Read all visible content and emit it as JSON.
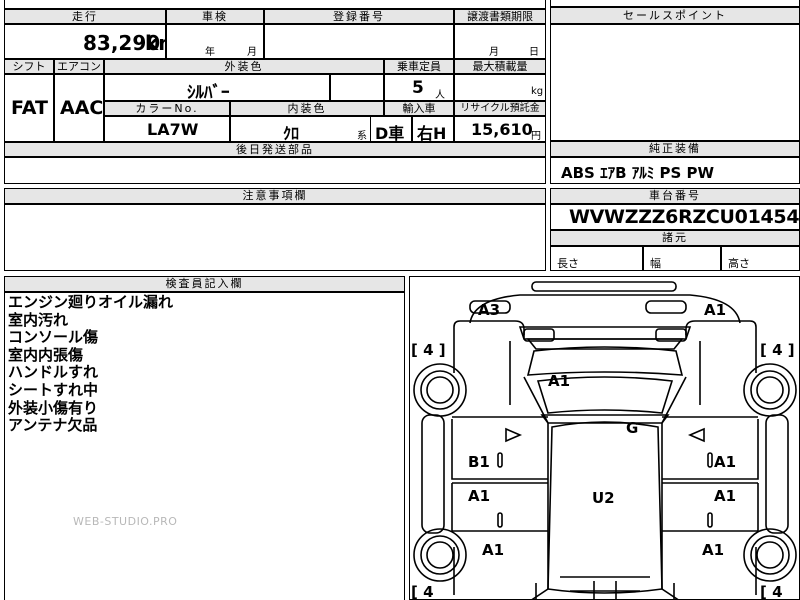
{
  "header": {
    "mileage_label": "走行",
    "inspection_label": "車検",
    "registration_label": "登録番号",
    "transfer_deadline_label": "譲渡書類期限",
    "sales_point_label": "セールスポイント",
    "mileage_value": "83,290",
    "mileage_unit": "km",
    "year_unit": "年",
    "month_unit": "月",
    "deadline_month_unit": "月",
    "deadline_day_unit": "日"
  },
  "spec": {
    "shift_label": "シフト",
    "aircon_label": "エアコン",
    "exterior_color_label": "外装色",
    "capacity_label": "乗車定員",
    "max_load_label": "最大積載量",
    "shift_value": "FAT",
    "aircon_value": "AAC",
    "exterior_color_value": "ｼﾙﾊﾞｰ",
    "capacity_value": "5",
    "capacity_unit": "人",
    "load_unit": "kg",
    "color_no_label": "カラーNo.",
    "interior_color_label": "内装色",
    "import_label": "輸入車",
    "recycle_label": "リサイクル預託金",
    "color_no_value": "LA7W",
    "interior_color_value": "ｸﾛ",
    "interior_suffix": "系",
    "import_value_1": "D車",
    "import_value_2": "右H",
    "recycle_value": "15,610",
    "recycle_unit": "円",
    "later_parts_label": "後日発送部品"
  },
  "equipment": {
    "label": "純正装備",
    "value": "ABS ｴｱB ｱﾙﾐ PS PW"
  },
  "notes_section": {
    "label": "注意事項欄"
  },
  "chassis": {
    "label": "車台番号",
    "value": "WVWZZZ6RZCU014549",
    "dims_label": "諸元",
    "length_label": "長さ",
    "width_label": "幅",
    "height_label": "高さ"
  },
  "inspector": {
    "label": "検査員記入欄",
    "lines": [
      "エンジン廻りオイル漏れ",
      "室内汚れ",
      "コンソール傷",
      "室内内張傷",
      "ハンドルすれ",
      "シートすれ中",
      "外装小傷有り",
      "アンテナ欠品"
    ]
  },
  "watermark": "WEB-STUDIO.PRO",
  "diagram": {
    "front_left": "A3",
    "front_right": "A1",
    "hood": "A1",
    "windshield_area": "G",
    "left_front_door": "B1",
    "right_front_door": "A1",
    "left_rear_door": "A1",
    "right_rear_door": "A1",
    "roof": "U2",
    "left_rear_fender": "A1",
    "right_rear_fender": "A1",
    "tire_fl": "[ 4 ]",
    "tire_fr": "[ 4 ]",
    "tire_rl": "[ 4",
    "tire_rr": "[ 4"
  }
}
